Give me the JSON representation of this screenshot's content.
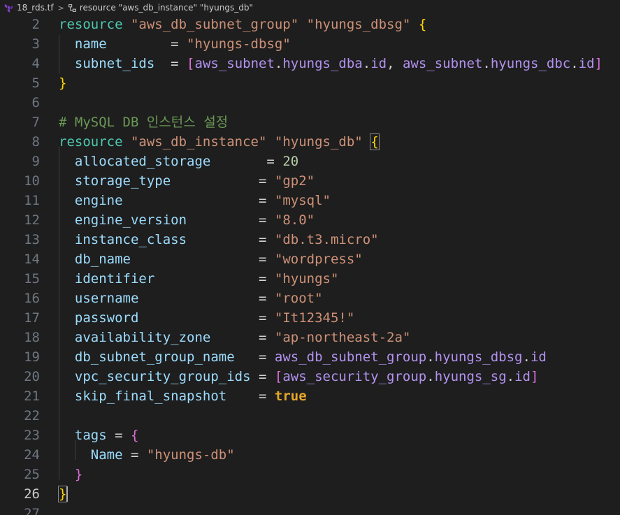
{
  "breadcrumb": {
    "file": "18_rds.tf",
    "separator": ">",
    "symbol": "resource \"aws_db_instance\" \"hyungs_db\""
  },
  "active_line": 26,
  "lines": [
    {
      "n": "2",
      "tokens": [
        [
          "k",
          "resource"
        ],
        [
          "o",
          " "
        ],
        [
          "s",
          "\"aws_db_subnet_group\""
        ],
        [
          "o",
          " "
        ],
        [
          "s",
          "\"hyungs_dbsg\""
        ],
        [
          "o",
          " "
        ],
        [
          "y",
          "{"
        ]
      ]
    },
    {
      "n": "3",
      "tokens": [
        [
          "o",
          "  "
        ],
        [
          "a",
          "name"
        ],
        [
          "o",
          "        = "
        ],
        [
          "s",
          "\"hyungs-dbsg\""
        ]
      ]
    },
    {
      "n": "4",
      "tokens": [
        [
          "o",
          "  "
        ],
        [
          "a",
          "subnet_ids"
        ],
        [
          "o",
          "  = "
        ],
        [
          "p",
          "["
        ],
        [
          "r",
          "aws_subnet"
        ],
        [
          "o",
          "."
        ],
        [
          "r",
          "hyungs_dba"
        ],
        [
          "o",
          "."
        ],
        [
          "r",
          "id"
        ],
        [
          "o",
          ", "
        ],
        [
          "r",
          "aws_subnet"
        ],
        [
          "o",
          "."
        ],
        [
          "r",
          "hyungs_dbc"
        ],
        [
          "o",
          "."
        ],
        [
          "r",
          "id"
        ],
        [
          "p",
          "]"
        ]
      ]
    },
    {
      "n": "5",
      "tokens": [
        [
          "y",
          "}"
        ]
      ]
    },
    {
      "n": "6",
      "tokens": []
    },
    {
      "n": "7",
      "tokens": [
        [
          "c",
          "# MySQL DB 인스턴스 설정"
        ]
      ]
    },
    {
      "n": "8",
      "tokens": [
        [
          "k",
          "resource"
        ],
        [
          "o",
          " "
        ],
        [
          "s",
          "\"aws_db_instance\""
        ],
        [
          "o",
          " "
        ],
        [
          "s",
          "\"hyungs_db\""
        ],
        [
          "o",
          " "
        ],
        [
          "y",
          "{"
        ]
      ]
    },
    {
      "n": "9",
      "tokens": [
        [
          "o",
          "  "
        ],
        [
          "a",
          "allocated_storage"
        ],
        [
          "o",
          "       = "
        ],
        [
          "n",
          "20"
        ]
      ]
    },
    {
      "n": "10",
      "tokens": [
        [
          "o",
          "  "
        ],
        [
          "a",
          "storage_type"
        ],
        [
          "o",
          "           = "
        ],
        [
          "s",
          "\"gp2\""
        ]
      ]
    },
    {
      "n": "11",
      "tokens": [
        [
          "o",
          "  "
        ],
        [
          "a",
          "engine"
        ],
        [
          "o",
          "                 = "
        ],
        [
          "s",
          "\"mysql\""
        ]
      ]
    },
    {
      "n": "12",
      "tokens": [
        [
          "o",
          "  "
        ],
        [
          "a",
          "engine_version"
        ],
        [
          "o",
          "         = "
        ],
        [
          "s",
          "\"8.0\""
        ]
      ]
    },
    {
      "n": "13",
      "tokens": [
        [
          "o",
          "  "
        ],
        [
          "a",
          "instance_class"
        ],
        [
          "o",
          "         = "
        ],
        [
          "s",
          "\"db.t3.micro\""
        ]
      ]
    },
    {
      "n": "14",
      "tokens": [
        [
          "o",
          "  "
        ],
        [
          "a",
          "db_name"
        ],
        [
          "o",
          "                = "
        ],
        [
          "s",
          "\"wordpress\""
        ]
      ]
    },
    {
      "n": "15",
      "tokens": [
        [
          "o",
          "  "
        ],
        [
          "a",
          "identifier"
        ],
        [
          "o",
          "             = "
        ],
        [
          "s",
          "\"hyungs\""
        ]
      ]
    },
    {
      "n": "16",
      "tokens": [
        [
          "o",
          "  "
        ],
        [
          "a",
          "username"
        ],
        [
          "o",
          "               = "
        ],
        [
          "s",
          "\"root\""
        ]
      ]
    },
    {
      "n": "17",
      "tokens": [
        [
          "o",
          "  "
        ],
        [
          "a",
          "password"
        ],
        [
          "o",
          "               = "
        ],
        [
          "s",
          "\"It12345!\""
        ]
      ]
    },
    {
      "n": "18",
      "tokens": [
        [
          "o",
          "  "
        ],
        [
          "a",
          "availability_zone"
        ],
        [
          "o",
          "      = "
        ],
        [
          "s",
          "\"ap-northeast-2a\""
        ]
      ]
    },
    {
      "n": "19",
      "tokens": [
        [
          "o",
          "  "
        ],
        [
          "a",
          "db_subnet_group_name"
        ],
        [
          "o",
          "   = "
        ],
        [
          "r",
          "aws_db_subnet_group"
        ],
        [
          "o",
          "."
        ],
        [
          "r",
          "hyungs_dbsg"
        ],
        [
          "o",
          "."
        ],
        [
          "r",
          "id"
        ]
      ]
    },
    {
      "n": "20",
      "tokens": [
        [
          "o",
          "  "
        ],
        [
          "a",
          "vpc_security_group_ids"
        ],
        [
          "o",
          " = "
        ],
        [
          "p",
          "["
        ],
        [
          "r",
          "aws_security_group"
        ],
        [
          "o",
          "."
        ],
        [
          "r",
          "hyungs_sg"
        ],
        [
          "o",
          "."
        ],
        [
          "r",
          "id"
        ],
        [
          "p",
          "]"
        ]
      ]
    },
    {
      "n": "21",
      "tokens": [
        [
          "o",
          "  "
        ],
        [
          "a",
          "skip_final_snapshot"
        ],
        [
          "o",
          "    = "
        ],
        [
          "bool",
          "true"
        ]
      ]
    },
    {
      "n": "22",
      "tokens": []
    },
    {
      "n": "23",
      "tokens": [
        [
          "o",
          "  "
        ],
        [
          "a",
          "tags"
        ],
        [
          "o",
          " = "
        ],
        [
          "p",
          "{"
        ]
      ]
    },
    {
      "n": "24",
      "tokens": [
        [
          "o",
          "    "
        ],
        [
          "a",
          "Name"
        ],
        [
          "o",
          " = "
        ],
        [
          "s",
          "\"hyungs-db\""
        ]
      ]
    },
    {
      "n": "25",
      "tokens": [
        [
          "o",
          "  "
        ],
        [
          "p",
          "}"
        ]
      ]
    },
    {
      "n": "26",
      "tokens": [
        [
          "y",
          "}"
        ]
      ]
    },
    {
      "n": "27",
      "tokens": []
    }
  ]
}
